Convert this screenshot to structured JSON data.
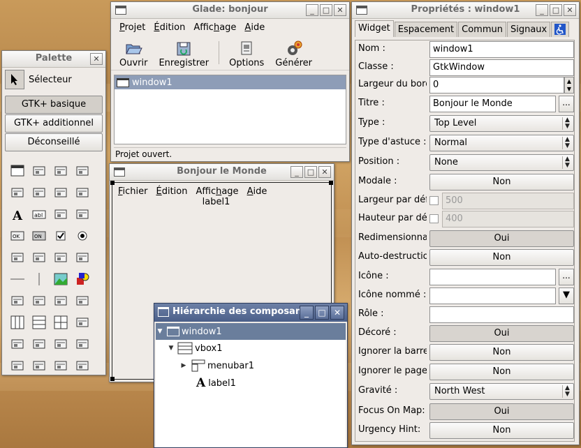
{
  "palette": {
    "title": "Palette",
    "selector_label": "Sélecteur",
    "groups": [
      "GTK+ basique",
      "GTK+ additionnel",
      "Déconseillé"
    ],
    "icons": [
      "window-icon",
      "menubar-icon",
      "toolbar-icon",
      "handlebox-icon",
      "hbuttonbox-icon",
      "vbuttonbox-icon",
      "radio-toolbar-icon",
      "separator-toolbar-icon",
      "label-icon",
      "entry-icon",
      "textview-icon",
      "text-icon",
      "button-icon",
      "togglebutton-icon",
      "checkbutton-icon",
      "radiobutton-icon",
      "combo-icon",
      "spinbutton-icon",
      "tree-icon",
      "list-icon",
      "hseparator-icon",
      "vseparator-icon",
      "image-icon",
      "drawingarea-icon",
      "dialog-icon",
      "filechooser-icon",
      "colorselection-icon",
      "fontselection-icon",
      "hbox-icon",
      "vbox-icon",
      "table-icon",
      "fixed-icon",
      "hpaned-icon",
      "hscale-icon",
      "vscale-icon",
      "scrollbar-icon",
      "notebook-icon",
      "frame-icon",
      "alignment-icon",
      "ruler-icon"
    ]
  },
  "glade": {
    "title": "Glade: bonjour",
    "menu": [
      {
        "pre": "",
        "u": "P",
        "post": "rojet"
      },
      {
        "pre": "",
        "u": "É",
        "post": "dition"
      },
      {
        "pre": "Affic",
        "u": "h",
        "post": "age"
      },
      {
        "pre": "",
        "u": "A",
        "post": "ide"
      }
    ],
    "toolbar": [
      "Ouvrir",
      "Enregistrer",
      "Options",
      "Générer"
    ],
    "project_item": "window1",
    "status": "Projet ouvert."
  },
  "bonjour": {
    "title": "Bonjour le Monde",
    "menu": [
      {
        "pre": "",
        "u": "F",
        "post": "ichier"
      },
      {
        "pre": "",
        "u": "É",
        "post": "dition"
      },
      {
        "pre": "Affic",
        "u": "h",
        "post": "age"
      },
      {
        "pre": "",
        "u": "A",
        "post": "ide"
      }
    ],
    "label": "label1"
  },
  "hierarchy": {
    "title": "Hiérarchie des composants",
    "nodes": [
      "window1",
      "vbox1",
      "menubar1",
      "label1"
    ]
  },
  "props": {
    "title": "Propriétés : window1",
    "tabs": [
      "Widget",
      "Espacement",
      "Commun",
      "Signaux"
    ],
    "rows": {
      "nom": {
        "label": "Nom :",
        "value": "window1"
      },
      "classe": {
        "label": "Classe :",
        "value": "GtkWindow"
      },
      "bord": {
        "label": "Largeur du bord :",
        "value": "0"
      },
      "titre": {
        "label": "Titre :",
        "value": "Bonjour le Monde"
      },
      "type": {
        "label": "Type :",
        "value": "Top Level"
      },
      "astuce": {
        "label": "Type d'astuce :",
        "value": "Normal"
      },
      "position": {
        "label": "Position :",
        "value": "None"
      },
      "modale": {
        "label": "Modale :",
        "value": "Non"
      },
      "largeur": {
        "label": "Largeur par défaut :",
        "value": "500"
      },
      "hauteur": {
        "label": "Hauteur par défaut :",
        "value": "400"
      },
      "redim": {
        "label": "Redimensionnable :",
        "value": "Oui"
      },
      "autodes": {
        "label": "Auto-destruction :",
        "value": "Non"
      },
      "icone": {
        "label": "Icône :",
        "value": ""
      },
      "iconenom": {
        "label": "Icône nommé :",
        "value": ""
      },
      "role": {
        "label": "Rôle :",
        "value": ""
      },
      "decore": {
        "label": "Décoré :",
        "value": "Oui"
      },
      "ignbarre": {
        "label": "Ignorer la barre des tâches :",
        "value": "Non"
      },
      "ignpager": {
        "label": "Ignorer le pager :",
        "value": "Non"
      },
      "gravite": {
        "label": "Gravité :",
        "value": "North West"
      },
      "focus": {
        "label": "Focus On Map:",
        "value": "Oui"
      },
      "urgency": {
        "label": "Urgency Hint:",
        "value": "Non"
      }
    },
    "ellipsis": "..."
  }
}
